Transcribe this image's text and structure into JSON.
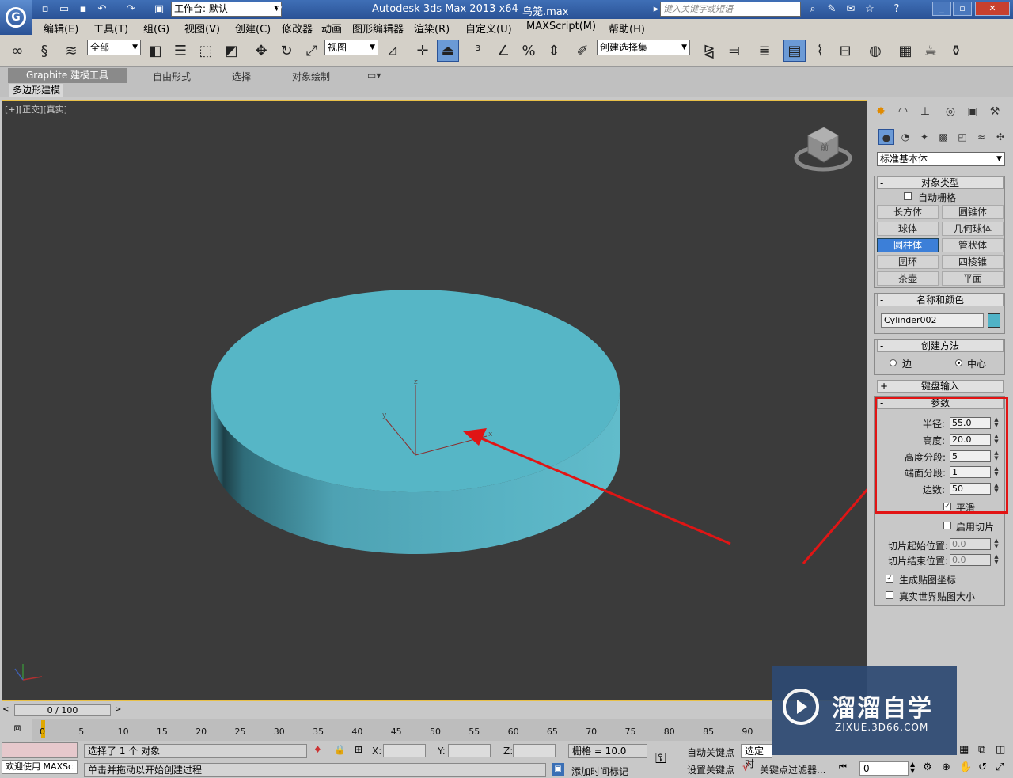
{
  "titlebar": {
    "workspace": "工作台: 默认",
    "app_title": "Autodesk 3ds Max  2013 x64",
    "file_name": "鸟笼.max",
    "search_placeholder": "键入关键字或短语"
  },
  "menubar": [
    "编辑(E)",
    "工具(T)",
    "组(G)",
    "视图(V)",
    "创建(C)",
    "修改器",
    "动画",
    "图形编辑器",
    "渲染(R)",
    "自定义(U)",
    "MAXScript(M)",
    "帮助(H)"
  ],
  "toolbar": {
    "selection_filter": "全部",
    "ref_coord": "视图",
    "named_selection": "创建选择集"
  },
  "ribbon": {
    "tabs": [
      "Graphite 建模工具",
      "自由形式",
      "选择",
      "对象绘制"
    ],
    "sub_label": "多边形建模"
  },
  "viewport": {
    "label": "[+][正交][真实]",
    "viewcube_label": "前",
    "object_color": "#56b6c6"
  },
  "command_panel": {
    "category": "标准基本体",
    "object_type": {
      "title": "对象类型",
      "autogrid": "自动栅格",
      "buttons": [
        "长方体",
        "圆锥体",
        "球体",
        "几何球体",
        "圆柱体",
        "管状体",
        "圆环",
        "四棱锥",
        "茶壶",
        "平面"
      ],
      "active": "圆柱体"
    },
    "name_color": {
      "title": "名称和颜色",
      "name": "Cylinder002",
      "color": "#4fb2c6"
    },
    "creation_method": {
      "title": "创建方法",
      "options": [
        "边",
        "中心"
      ],
      "selected": "中心"
    },
    "keyboard_entry": "键盘输入",
    "parameters": {
      "title": "参数",
      "radius_label": "半径:",
      "radius": "55.0",
      "height_label": "高度:",
      "height": "20.0",
      "height_segs_label": "高度分段:",
      "height_segs": "5",
      "cap_segs_label": "端面分段:",
      "cap_segs": "1",
      "sides_label": "边数:",
      "sides": "50",
      "smooth": "平滑",
      "slice_on": "启用切片",
      "slice_from_label": "切片起始位置:",
      "slice_from": "0.0",
      "slice_to_label": "切片结束位置:",
      "slice_to": "0.0",
      "gen_map": "生成贴图坐标",
      "real_world": "真实世界贴图大小"
    }
  },
  "timeline": {
    "frame": "0 / 100",
    "ticks": [
      "0",
      "5",
      "10",
      "15",
      "20",
      "25",
      "30",
      "35",
      "40",
      "45",
      "50",
      "55",
      "60",
      "65",
      "70",
      "75",
      "80",
      "85",
      "90"
    ]
  },
  "status": {
    "maxscript": "欢迎使用 MAXSc",
    "selection": "选择了 1 个 对象",
    "prompt": "单击并拖动以开始创建过程",
    "x_label": "X:",
    "y_label": "Y:",
    "z_label": "Z:",
    "grid": "栅格 = 10.0",
    "add_time_tag": "添加时间标记",
    "auto_key": "自动关键点",
    "selected": "选定对",
    "set_key": "设置关键点",
    "key_filters": "关键点过滤器...",
    "frame_value": "0"
  },
  "watermark": {
    "brand": "溜溜自学",
    "url": "ZIXUE.3D66.COM"
  }
}
